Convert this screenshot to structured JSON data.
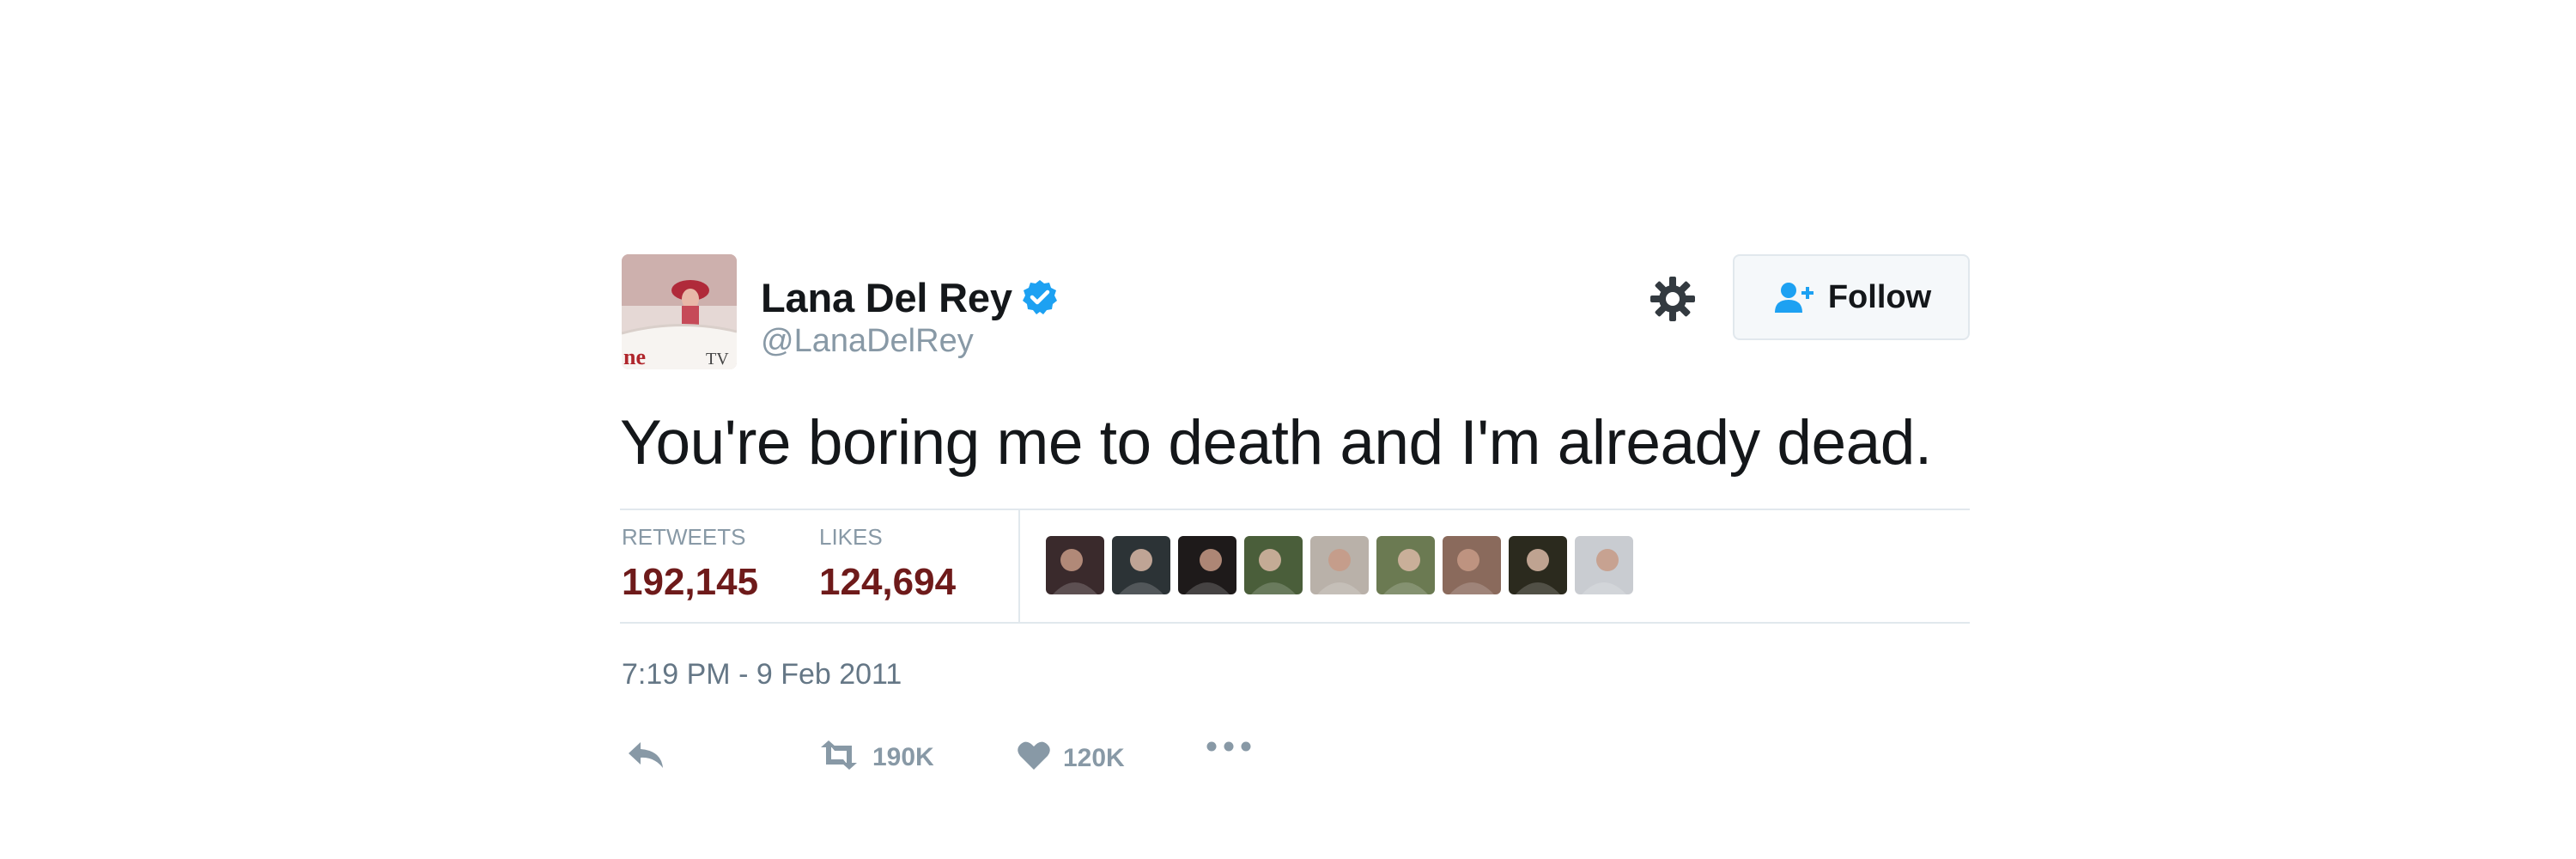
{
  "user": {
    "name": "Lana Del Rey",
    "handle": "@LanaDelRey",
    "verified": true,
    "avatar_text": "ne TV"
  },
  "header": {
    "follow_label": "Follow"
  },
  "tweet": {
    "text": "You're boring me to death and I'm already dead.",
    "timestamp": "7:19 PM - 9 Feb 2011"
  },
  "stats": {
    "retweets_label": "RETWEETS",
    "retweets_value": "192,145",
    "likes_label": "LIKES",
    "likes_value": "124,694"
  },
  "liker_avatars": [
    {
      "name": "liker-1",
      "color": "#3a2a2c"
    },
    {
      "name": "liker-2",
      "color": "#2c3336"
    },
    {
      "name": "liker-3",
      "color": "#1e1a1a"
    },
    {
      "name": "liker-4",
      "color": "#4a5e3a"
    },
    {
      "name": "liker-5",
      "color": "#b9b1a9"
    },
    {
      "name": "liker-6",
      "color": "#6b7a52"
    },
    {
      "name": "liker-7",
      "color": "#8a6a5c"
    },
    {
      "name": "liker-8",
      "color": "#2b2a1e"
    },
    {
      "name": "liker-9",
      "color": "#c9ccd1"
    }
  ],
  "actions": {
    "retweet_count": "190K",
    "like_count": "120K"
  },
  "icons": {
    "verified": "verified-badge-icon",
    "gear": "gear-icon",
    "follow": "add-user-icon",
    "reply": "reply-icon",
    "retweet": "retweet-icon",
    "like": "heart-icon",
    "more": "more-dots-icon"
  },
  "colors": {
    "verified_blue": "#1da1f2",
    "follow_icon_blue": "#1da1f2",
    "stat_value": "#6e1a1a",
    "muted": "#8899a6"
  }
}
